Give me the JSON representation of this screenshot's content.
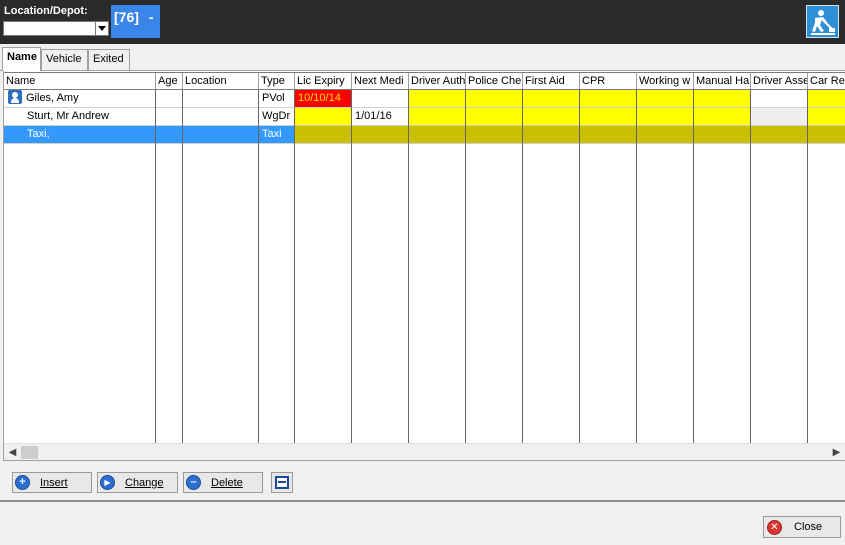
{
  "header": {
    "location_label": "Location/Depot:",
    "location_value": "",
    "badge": "[76]",
    "badge_suffix": "-"
  },
  "tabs": [
    {
      "label": "Name",
      "active": true
    },
    {
      "label": "Vehicle",
      "active": false
    },
    {
      "label": "Exited",
      "active": false
    }
  ],
  "grid": {
    "columns": [
      "Name",
      "Age",
      "Location",
      "Type",
      "Lic Expiry",
      "Next Medi",
      "Driver Auth",
      "Police Che",
      "First Aid",
      "CPR",
      "Working w",
      "Manual Ha",
      "Driver Asse",
      "Car Re"
    ],
    "rows": [
      {
        "name": "Giles,  Amy",
        "age": "",
        "location": "",
        "type": "PVol",
        "lic_expiry": "10/10/14",
        "next_medi": "",
        "selected": false
      },
      {
        "name": "Sturt, Mr Andrew",
        "age": "",
        "location": "",
        "type": "WgDr",
        "lic_expiry": "",
        "next_medi": "1/01/16",
        "selected": false
      },
      {
        "name": "Taxi,",
        "age": "",
        "location": "",
        "type": "Taxi",
        "lic_expiry": "",
        "next_medi": "",
        "selected": true
      }
    ]
  },
  "buttons": {
    "insert": "Insert",
    "change": "Change",
    "delete": "Delete",
    "close": "Close"
  },
  "colors": {
    "topbar": "#2b2b2b",
    "badge": "#3a86e8",
    "selected_row": "#3399ff",
    "warning": "#ffff00",
    "expired": "#ff0000"
  }
}
